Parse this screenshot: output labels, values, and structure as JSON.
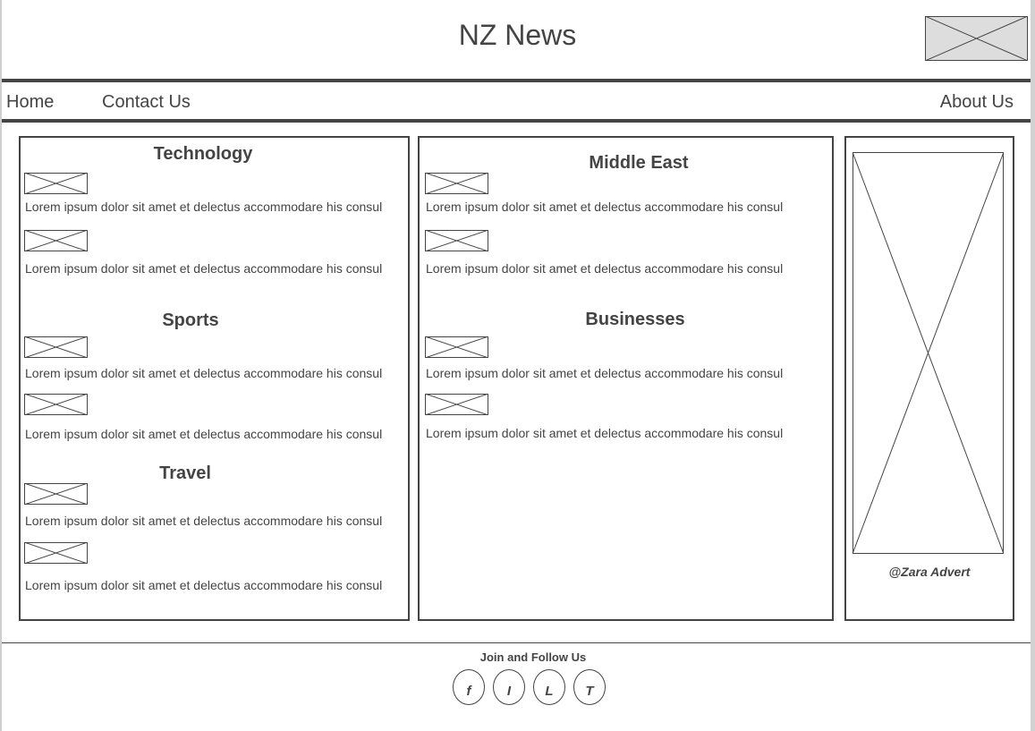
{
  "header": {
    "title": "NZ News"
  },
  "nav": {
    "home": "Home",
    "contact": "Contact Us",
    "about": "About Us"
  },
  "sections": {
    "technology": {
      "title": "Technology",
      "items": [
        "Lorem ipsum dolor sit amet et delectus accommodare his consul",
        "Lorem ipsum dolor sit amet et delectus accommodare his consul"
      ]
    },
    "sports": {
      "title": "Sports",
      "items": [
        "Lorem ipsum dolor sit amet et delectus accommodare his consul",
        "Lorem ipsum dolor sit amet et delectus accommodare his consul"
      ]
    },
    "travel": {
      "title": "Travel",
      "items": [
        "Lorem ipsum dolor sit amet et delectus accommodare his consul",
        "Lorem ipsum dolor sit amet et delectus accommodare his consul"
      ]
    },
    "middle_east": {
      "title": "Middle East",
      "items": [
        "Lorem ipsum dolor sit amet et delectus accommodare his consul",
        "Lorem ipsum dolor sit amet et delectus accommodare his consul"
      ]
    },
    "businesses": {
      "title": "Businesses",
      "items": [
        "Lorem ipsum dolor sit amet et delectus accommodare his consul",
        "Lorem ipsum dolor sit amet et delectus accommodare his consul"
      ]
    }
  },
  "advert": {
    "caption": "@Zara Advert"
  },
  "footer": {
    "text": "Join and Follow Us",
    "social": [
      "f",
      "I",
      "L",
      "T"
    ]
  },
  "icons": {
    "logo": "logo-placeholder-icon",
    "thumb": "image-placeholder-icon",
    "advert": "advert-image-placeholder-icon"
  },
  "colors": {
    "ink": "#444444",
    "placeholder_fill": "#dddddd"
  }
}
